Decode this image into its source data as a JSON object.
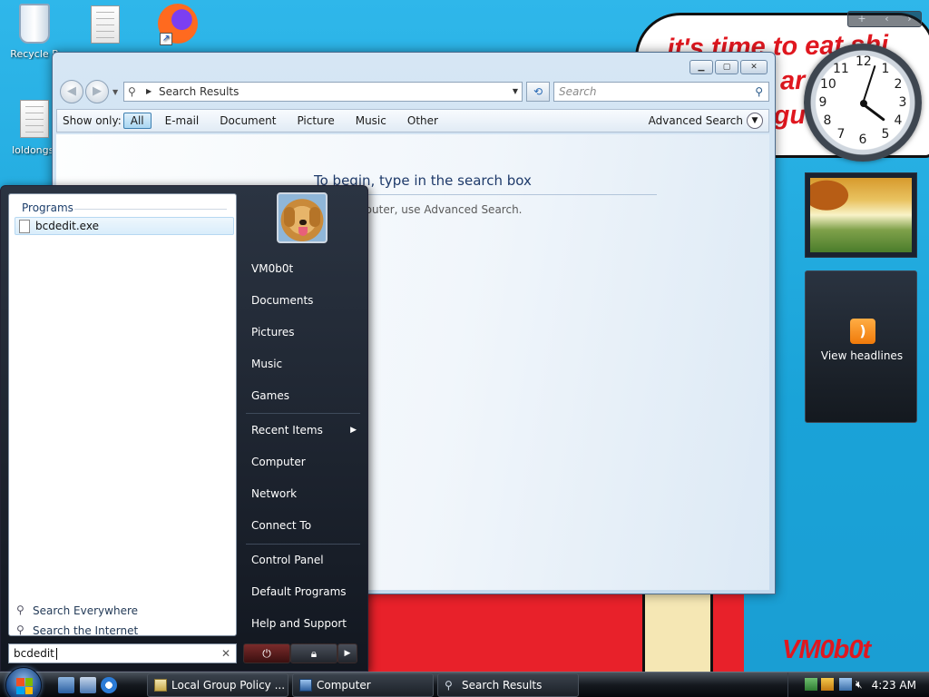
{
  "desktop": {
    "icons": [
      {
        "label": "Recycle B",
        "icon": "recycle-bin-icon"
      },
      {
        "label": "",
        "icon": "text-document-icon"
      },
      {
        "label": "",
        "icon": "firefox-icon"
      },
      {
        "label": "loldongs.",
        "icon": "text-document-icon"
      }
    ],
    "wallpaper_caption": [
      "it's time to eat shi",
      "ar",
      "gu"
    ],
    "wallpaper_signature": "VM0b0t"
  },
  "explorer": {
    "nav": {
      "back_icon": "back-arrow-icon",
      "forward_icon": "forward-arrow-icon"
    },
    "address": "Search Results",
    "search_placeholder": "Search",
    "filter": {
      "label": "Show only:",
      "options": [
        "All",
        "E-mail",
        "Document",
        "Picture",
        "Music",
        "Other"
      ],
      "selected": "All",
      "advanced_label": "Advanced Search"
    },
    "content": {
      "title": "To begin, type in the search box",
      "subtitle": "your computer, use Advanced Search."
    }
  },
  "start_menu": {
    "programs_header": "Programs",
    "program_result": "bcdedit.exe",
    "search_everywhere": "Search Everywhere",
    "search_internet": "Search the Internet",
    "search_value": "bcdedit",
    "user": "VM0b0t",
    "right_items": [
      "Documents",
      "Pictures",
      "Music",
      "Games"
    ],
    "recent_items": "Recent Items",
    "right_items_2": [
      "Computer",
      "Network",
      "Connect To"
    ],
    "right_items_3": [
      "Control Panel",
      "Default Programs",
      "Help and Support"
    ]
  },
  "gadgets": {
    "sidebar_controls": [
      "+",
      "‹",
      "›"
    ],
    "clock_numbers": [
      "12",
      "1",
      "2",
      "3",
      "4",
      "5",
      "6",
      "7",
      "8",
      "9",
      "10",
      "11"
    ],
    "feed_label": "View headlines"
  },
  "taskbar": {
    "buttons": [
      {
        "label": "Local Group Policy ...",
        "icon": "policy-icon"
      },
      {
        "label": "Computer",
        "icon": "computer-icon"
      },
      {
        "label": "Search Results",
        "icon": "search-icon"
      }
    ],
    "clock": "4:23 AM"
  },
  "colors": {
    "desktop": "#1aa7dc",
    "wallpaper_red": "#e0171f",
    "start_menu_dark": "#121720",
    "taskbar_dark": "#15191f"
  }
}
